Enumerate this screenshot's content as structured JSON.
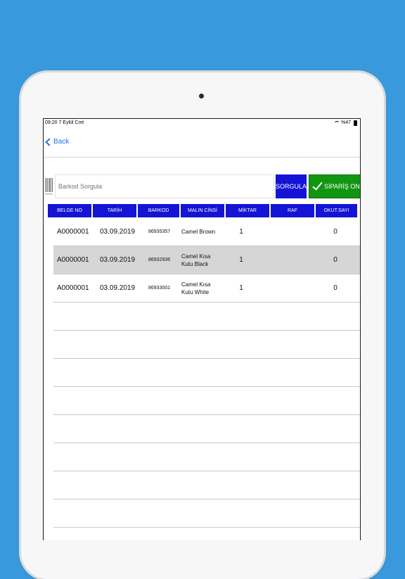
{
  "status_bar": {
    "time_date": "09:20  7 Eylül Cmt",
    "battery": "%47"
  },
  "nav": {
    "back_label": "Back"
  },
  "search": {
    "placeholder": "Barkod Sorgula",
    "query_button": "SORGULA",
    "approve_button": "SİPARİŞ ONAYLA"
  },
  "table": {
    "headers": [
      "BELGE NO",
      "TARİH",
      "BARKOD",
      "MALIN CİNSİ",
      "MİKTAR",
      "RAF",
      "OKUT.SAYI"
    ],
    "rows": [
      {
        "belge_no": "A0000001",
        "tarih": "03.09.2019",
        "barkod": "86935357",
        "malin_cinsi": "Camel Brown",
        "miktar": "1",
        "raf": "",
        "okut_sayi": "0"
      },
      {
        "belge_no": "A0000001",
        "tarih": "03.09.2019",
        "barkod": "86932936",
        "malin_cinsi": "Camel Kısa Kutu Black",
        "miktar": "1",
        "raf": "",
        "okut_sayi": "0"
      },
      {
        "belge_no": "A0000001",
        "tarih": "03.09.2019",
        "barkod": "86933001",
        "malin_cinsi": "Camel Kısa Kutu White",
        "miktar": "1",
        "raf": "",
        "okut_sayi": "0"
      },
      {
        "belge_no": "",
        "tarih": "",
        "barkod": "",
        "malin_cinsi": "",
        "miktar": "",
        "raf": "",
        "okut_sayi": ""
      },
      {
        "belge_no": "",
        "tarih": "",
        "barkod": "",
        "malin_cinsi": "",
        "miktar": "",
        "raf": "",
        "okut_sayi": ""
      },
      {
        "belge_no": "",
        "tarih": "",
        "barkod": "",
        "malin_cinsi": "",
        "miktar": "",
        "raf": "",
        "okut_sayi": ""
      },
      {
        "belge_no": "",
        "tarih": "",
        "barkod": "",
        "malin_cinsi": "",
        "miktar": "",
        "raf": "",
        "okut_sayi": ""
      },
      {
        "belge_no": "",
        "tarih": "",
        "barkod": "",
        "malin_cinsi": "",
        "miktar": "",
        "raf": "",
        "okut_sayi": ""
      },
      {
        "belge_no": "",
        "tarih": "",
        "barkod": "",
        "malin_cinsi": "",
        "miktar": "",
        "raf": "",
        "okut_sayi": ""
      },
      {
        "belge_no": "",
        "tarih": "",
        "barkod": "",
        "malin_cinsi": "",
        "miktar": "",
        "raf": "",
        "okut_sayi": ""
      },
      {
        "belge_no": "",
        "tarih": "",
        "barkod": "",
        "malin_cinsi": "",
        "miktar": "",
        "raf": "",
        "okut_sayi": ""
      },
      {
        "belge_no": "",
        "tarih": "",
        "barkod": "",
        "malin_cinsi": "",
        "miktar": "",
        "raf": "",
        "okut_sayi": ""
      }
    ]
  },
  "colors": {
    "header_blue": "#1414d6",
    "approve_green": "#129612",
    "link_blue": "#1a73e8",
    "background": "#3a99dc"
  },
  "icons": {
    "back": "chevron-left-icon",
    "barcode": "barcode-icon",
    "approve": "checkmark-icon",
    "wifi": "wifi-icon",
    "battery": "battery-icon"
  }
}
